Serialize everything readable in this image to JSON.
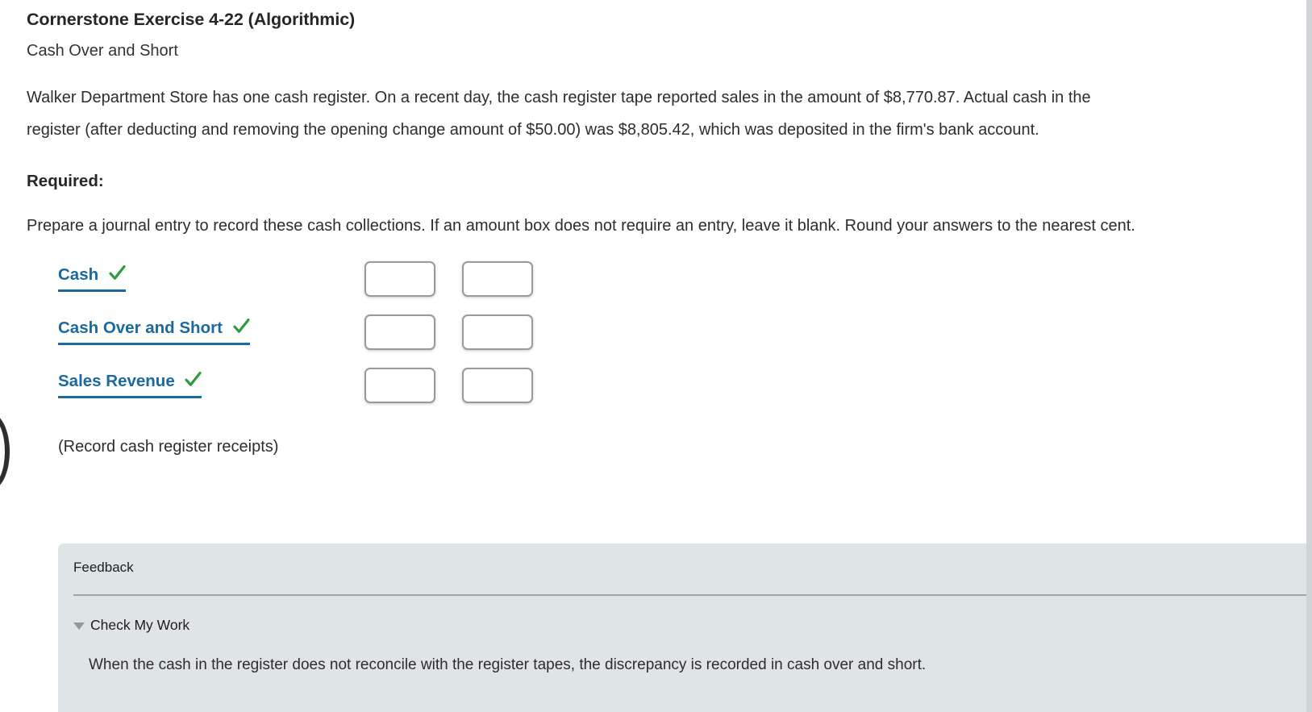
{
  "header": {
    "exercise_title": "Cornerstone Exercise 4-22 (Algorithmic)",
    "exercise_subtitle": "Cash Over and Short"
  },
  "problem": {
    "paragraph": "Walker Department Store has one cash register. On a recent day, the cash register tape reported sales in the amount of $8,770.87. Actual cash in the register (after deducting and removing the opening change amount of $50.00) was $8,805.42, which was deposited in the firm's bank account.",
    "required_label": "Required:",
    "required_text": "Prepare a journal entry to record these cash collections. If an amount box does not require an entry, leave it blank. Round your answers to the nearest cent."
  },
  "journal_entry": {
    "rows": [
      {
        "account": "Cash",
        "status_icon": "green-check-icon",
        "debit_value": "",
        "credit_value": ""
      },
      {
        "account": "Cash Over and Short",
        "status_icon": "green-check-icon",
        "debit_value": "",
        "credit_value": ""
      },
      {
        "account": "Sales Revenue",
        "status_icon": "green-check-icon",
        "debit_value": "",
        "credit_value": ""
      }
    ],
    "record_note": "(Record cash register receipts)"
  },
  "feedback": {
    "title": "Feedback",
    "toggle_icon": "triangle-down-icon",
    "toggle_label": "Check My Work",
    "body": "When the cash in the register does not reconcile with the register tapes, the discrepancy is recorded in cash over and short."
  },
  "colors": {
    "account_link": "#1b699f",
    "check_mark": "#2e9b3f",
    "feedback_bg": "#dfe5e7",
    "feedback_divider": "#9aa7ac",
    "input_border": "#9a9a9a",
    "text": "#2d2d2d"
  }
}
